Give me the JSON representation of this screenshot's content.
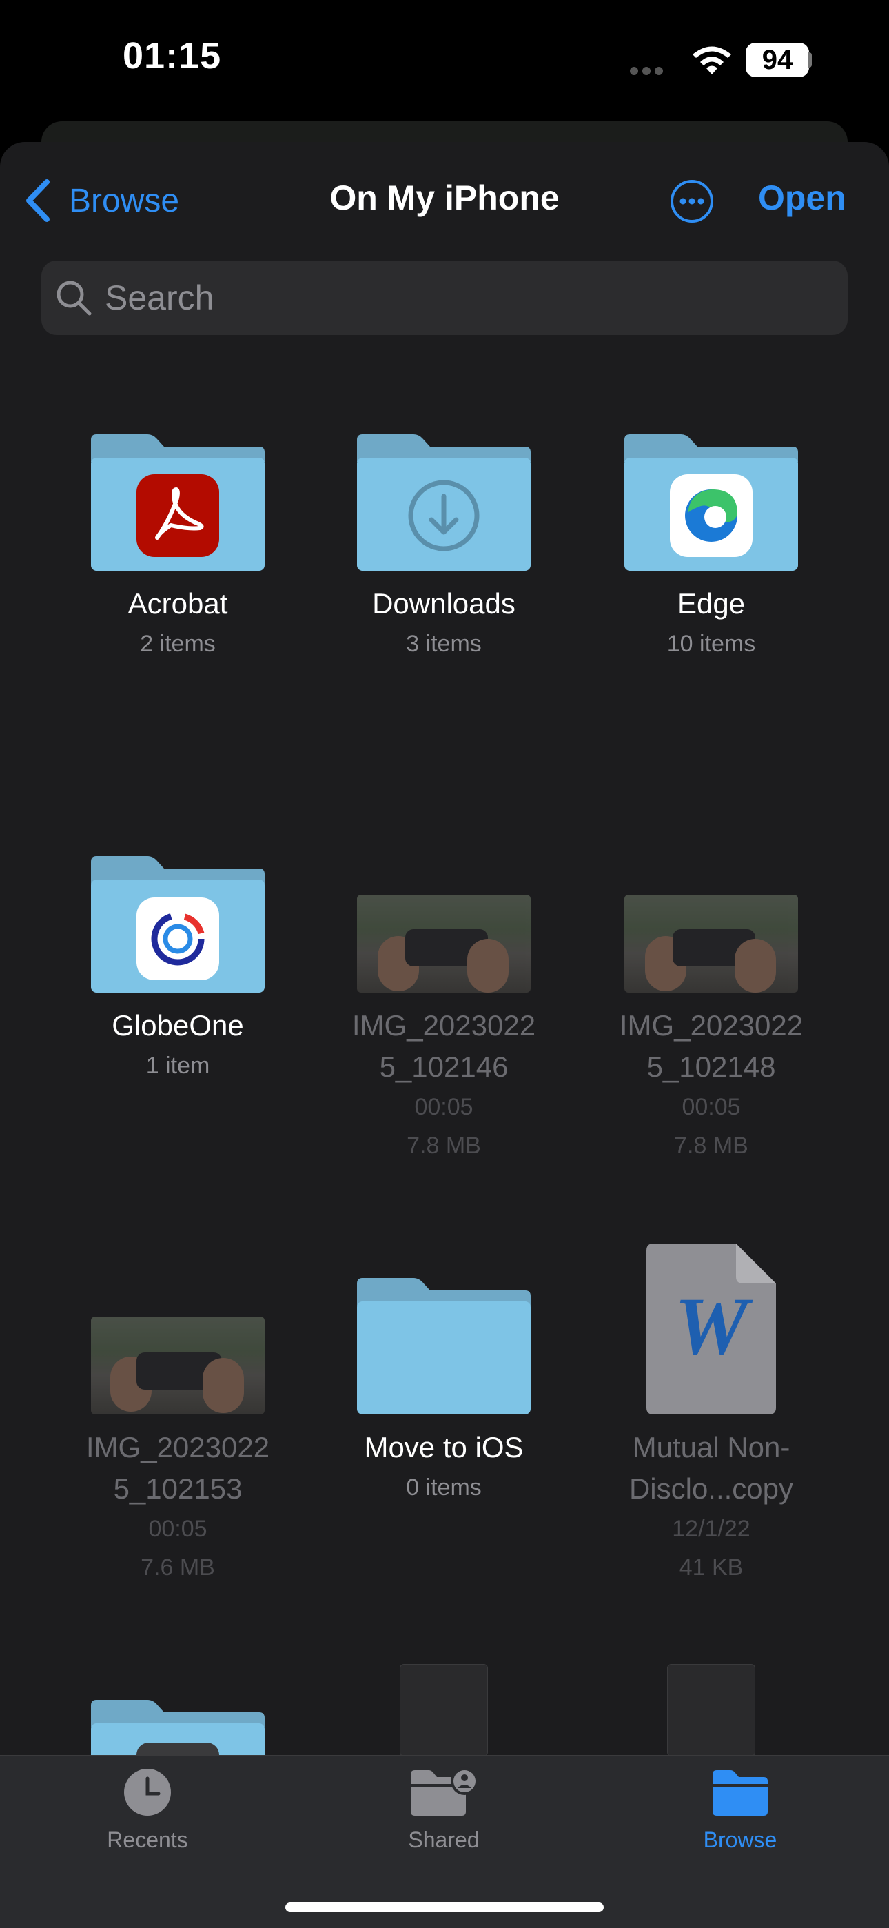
{
  "status_bar": {
    "time": "01:15",
    "battery": "94"
  },
  "nav": {
    "back_label": "Browse",
    "title": "On My iPhone",
    "open_label": "Open"
  },
  "search": {
    "placeholder": "Search"
  },
  "items": [
    {
      "name": "Acrobat",
      "sub": "2 items"
    },
    {
      "name": "Downloads",
      "sub": "3 items"
    },
    {
      "name": "Edge",
      "sub": "10 items"
    },
    {
      "name": "GlobeOne",
      "sub": "1 item"
    },
    {
      "name_line1": "IMG_2023022",
      "name_line2": "5_102146",
      "duration": "00:05",
      "size": "7.8 MB"
    },
    {
      "name_line1": "IMG_2023022",
      "name_line2": "5_102148",
      "duration": "00:05",
      "size": "7.8 MB"
    },
    {
      "name_line1": "IMG_2023022",
      "name_line2": "5_102153",
      "duration": "00:05",
      "size": "7.6 MB"
    },
    {
      "name": "Move to iOS",
      "sub": "0 items"
    },
    {
      "name_line1": "Mutual Non-",
      "name_line2": "Disclo...copy",
      "date": "12/1/22",
      "size": "41 KB"
    }
  ],
  "tabs": [
    {
      "label": "Recents"
    },
    {
      "label": "Shared"
    },
    {
      "label": "Browse"
    }
  ],
  "colors": {
    "accent": "#2f8ef4",
    "folder": "#7ec4e6",
    "background": "#1c1c1e"
  }
}
